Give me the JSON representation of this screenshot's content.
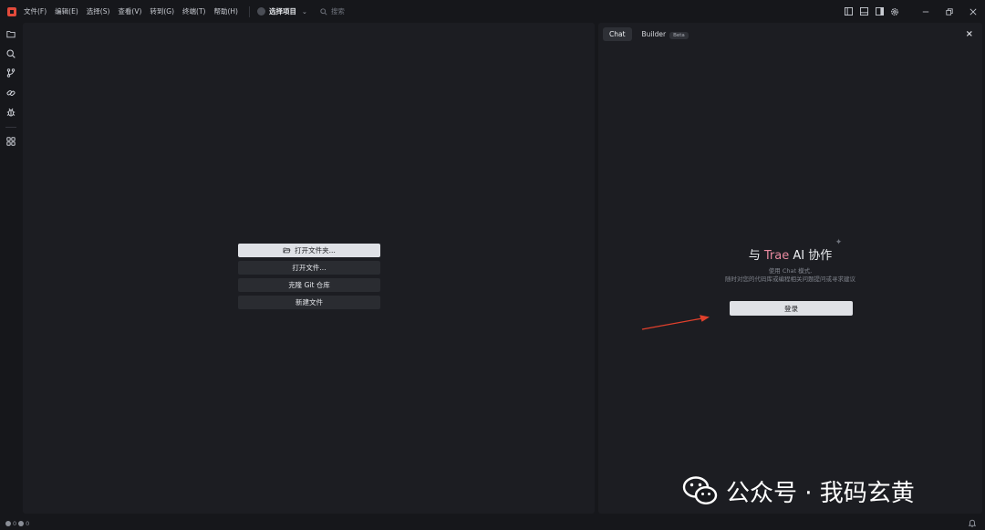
{
  "menu": [
    "文件(F)",
    "编辑(E)",
    "选择(S)",
    "查看(V)",
    "转到(G)",
    "终端(T)",
    "帮助(H)"
  ],
  "project": {
    "label": "选择项目"
  },
  "search": {
    "placeholder": "搜索"
  },
  "editor": {
    "open_folder": "打开文件夹...",
    "open_file": "打开文件...",
    "clone_git": "克隆 Git 仓库",
    "new_file": "新建文件"
  },
  "chat": {
    "tab_chat": "Chat",
    "tab_builder": "Builder",
    "beta": "Beta",
    "close": "×",
    "welcome_prefix": "与 ",
    "welcome_brand": "Trae",
    "welcome_suffix": " AI 协作",
    "subtitle_line1": "使用 Chat 模式,",
    "subtitle_line2": "随时对您的代码库或编程相关问题提问或寻求建议",
    "login": "登录"
  },
  "status": {
    "errors": "0",
    "warnings": "0"
  },
  "watermark": {
    "text": "公众号 · 我码玄黄"
  },
  "colors": {
    "accent_brand": "#e98aa0",
    "logo": "#e24a3b",
    "arrow": "#e0402c"
  }
}
